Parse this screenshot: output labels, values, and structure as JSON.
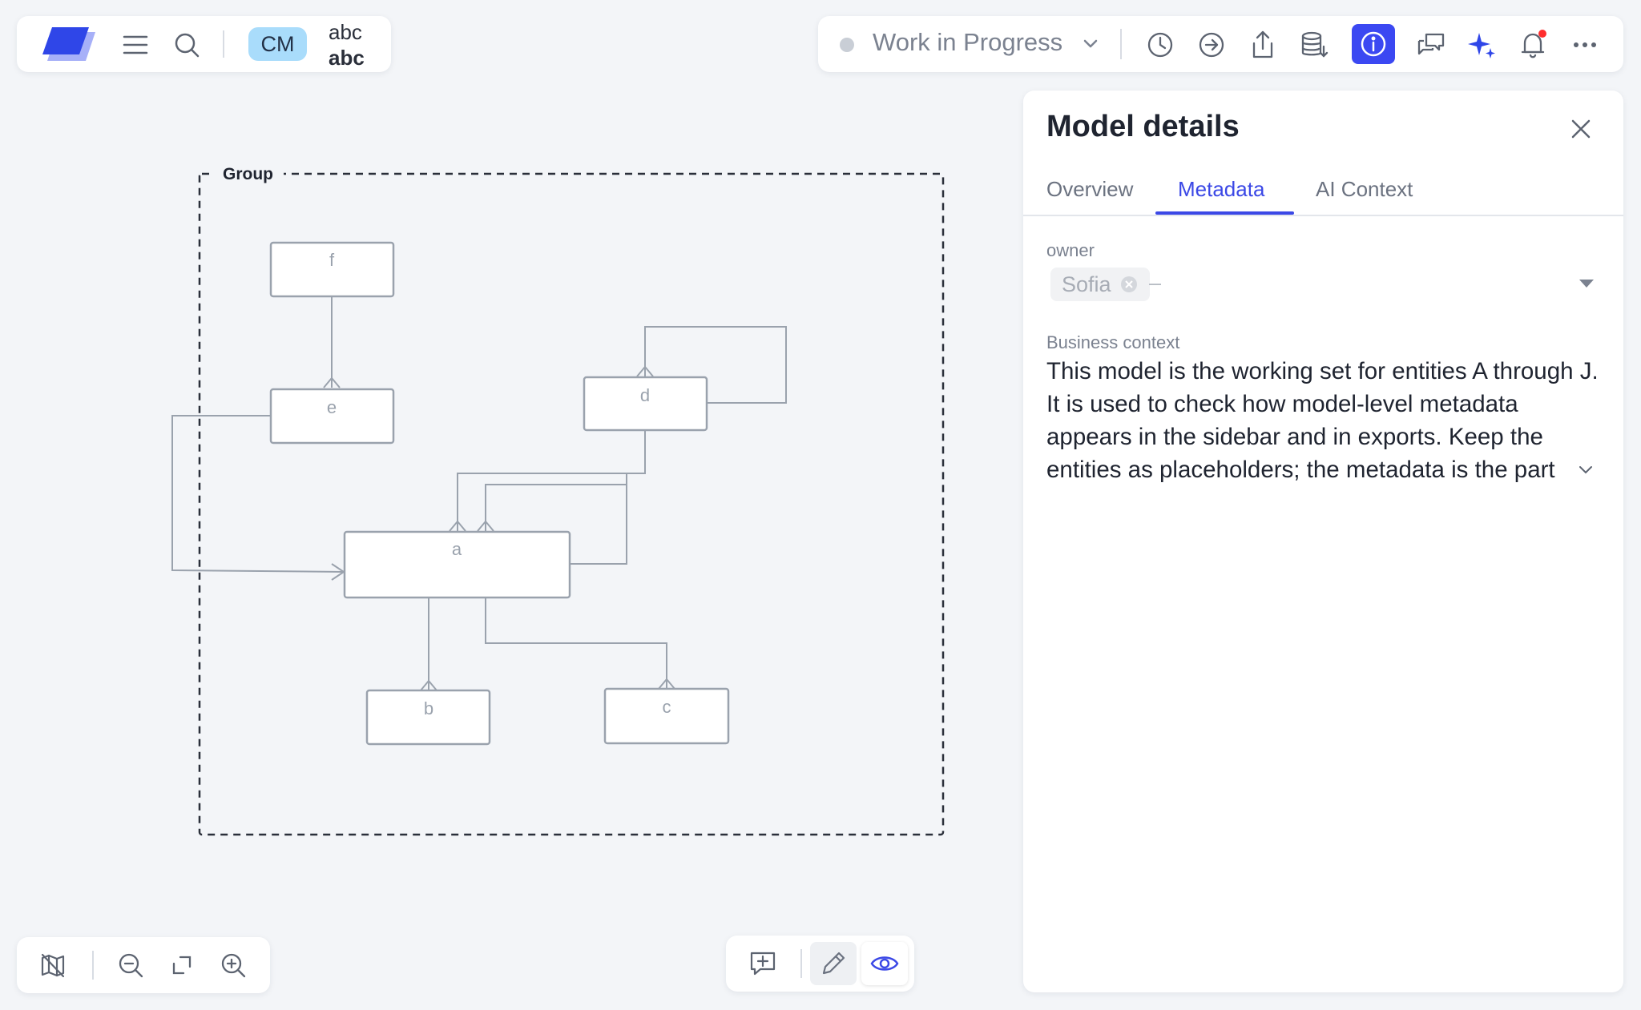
{
  "toolbar": {
    "avatar_initials": "CM",
    "project_line1": "abc",
    "project_line2": "abc",
    "status_label": "Work in Progress",
    "icons": [
      "menu-icon",
      "search-icon",
      "history-icon",
      "arrow-circle-right-icon",
      "share-icon",
      "database-import-icon",
      "info-icon",
      "comments-icon",
      "sparkle-icon",
      "bell-icon",
      "more-icon"
    ]
  },
  "panel": {
    "title": "Model details",
    "tabs": [
      {
        "label": "Overview",
        "active": false
      },
      {
        "label": "Metadata",
        "active": true
      },
      {
        "label": "AI Context",
        "active": false
      }
    ],
    "owner_label": "owner",
    "owner_value": "Sofia",
    "owner_placeholder": "–",
    "business_context_label": "Business context",
    "business_context_text": "This model is the working set for entities A through J. It is used to check how model-level metadata appears in the sidebar and in exports. Keep the entities as placeholders; the metadata is the part under test."
  },
  "canvas": {
    "group_label": "Group",
    "entities": [
      "f",
      "e",
      "d",
      "a",
      "b",
      "c"
    ]
  },
  "colors": {
    "accent": "#3b48e6",
    "notification_dot": "#ff2d2d",
    "avatar_bg": "#a9dcfb",
    "entity_stroke": "#9aa2ad"
  }
}
